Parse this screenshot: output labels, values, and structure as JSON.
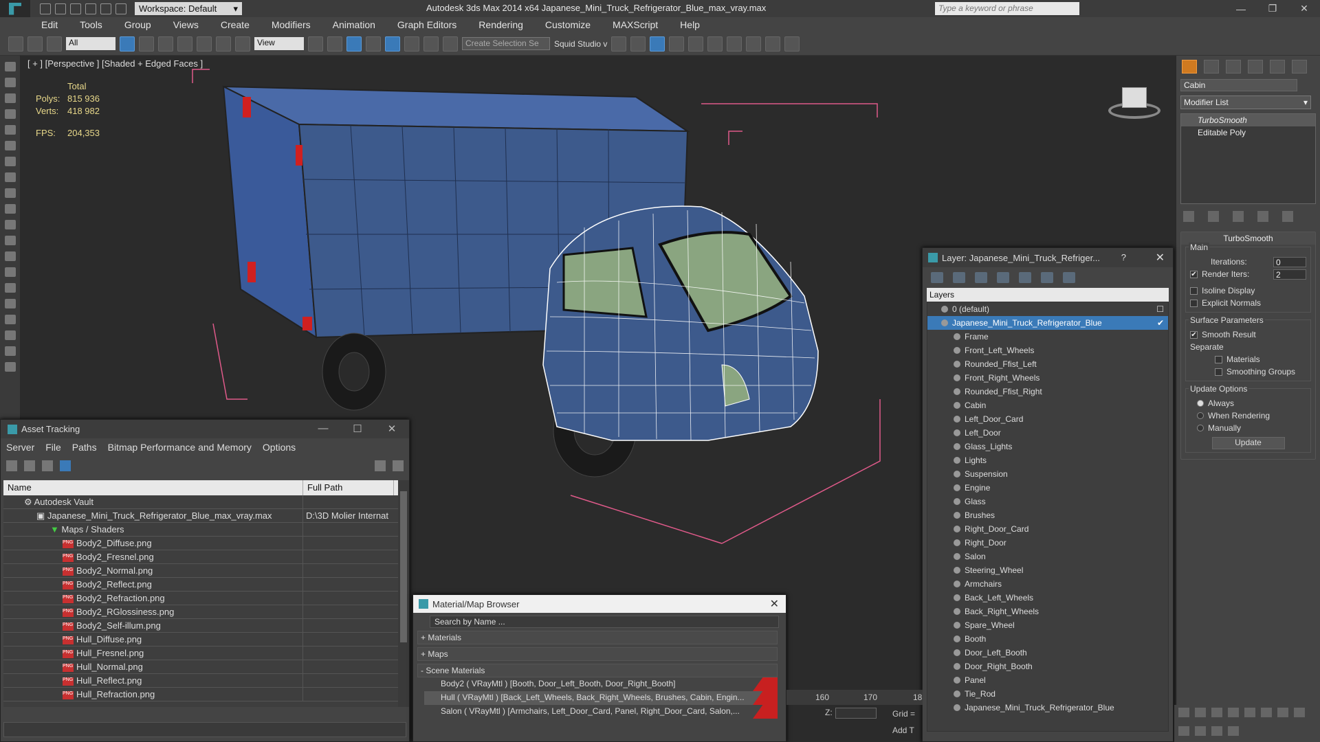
{
  "window": {
    "title": "Autodesk 3ds Max  2014 x64     Japanese_Mini_Truck_Refrigerator_Blue_max_vray.max",
    "workspace": "Workspace: Default",
    "search_placeholder": "Type a keyword or phrase"
  },
  "menu": [
    "Edit",
    "Tools",
    "Group",
    "Views",
    "Create",
    "Modifiers",
    "Animation",
    "Graph Editors",
    "Rendering",
    "Customize",
    "MAXScript",
    "Help"
  ],
  "toolbar": {
    "filter": "All",
    "ref_coord": "View",
    "selection_set": "Create Selection Se",
    "squid": "Squid Studio v"
  },
  "viewport": {
    "label": "[ + ] [Perspective ] [Shaded + Edged Faces ]",
    "stats": {
      "header": "Total",
      "polys_label": "Polys:",
      "polys": "815 936",
      "verts_label": "Verts:",
      "verts": "418 982",
      "fps_label": "FPS:",
      "fps": "204,353"
    }
  },
  "command_panel": {
    "object_name": "Cabin",
    "modifier_list": "Modifier List",
    "stack": [
      "TurboSmooth",
      "Editable Poly"
    ],
    "rollout_title": "TurboSmooth",
    "main_group": "Main",
    "iterations_label": "Iterations:",
    "iterations": "0",
    "render_iters_label": "Render Iters:",
    "render_iters": "2",
    "isoline": "Isoline Display",
    "explicit_normals": "Explicit Normals",
    "surface_group": "Surface Parameters",
    "smooth_result": "Smooth Result",
    "separate": "Separate",
    "materials": "Materials",
    "smoothing_groups": "Smoothing Groups",
    "update_group": "Update Options",
    "always": "Always",
    "when_rendering": "When Rendering",
    "manually": "Manually",
    "update_btn": "Update"
  },
  "layer_window": {
    "title": "Layer: Japanese_Mini_Truck_Refriger...",
    "help": "?",
    "header": "Layers",
    "default_layer": "0 (default)",
    "selected_layer": "Japanese_Mini_Truck_Refrigerator_Blue",
    "items": [
      "Frame",
      "Front_Left_Wheels",
      "Rounded_Ffist_Left",
      "Front_Right_Wheels",
      "Rounded_Ffist_Right",
      "Cabin",
      "Left_Door_Card",
      "Left_Door",
      "Glass_Lights",
      "Lights",
      "Suspension",
      "Engine",
      "Glass",
      "Brushes",
      "Right_Door_Card",
      "Right_Door",
      "Salon",
      "Steering_Wheel",
      "Armchairs",
      "Back_Left_Wheels",
      "Back_Right_Wheels",
      "Spare_Wheel",
      "Booth",
      "Door_Left_Booth",
      "Door_Right_Booth",
      "Panel",
      "Tie_Rod",
      "Japanese_Mini_Truck_Refrigerator_Blue"
    ]
  },
  "asset_window": {
    "title": "Asset Tracking",
    "menu": [
      "Server",
      "File",
      "Paths",
      "Bitmap Performance and Memory",
      "Options"
    ],
    "col_name": "Name",
    "col_path": "Full Path",
    "vault": "Autodesk Vault",
    "file": "Japanese_Mini_Truck_Refrigerator_Blue_max_vray.max",
    "file_path": "D:\\3D Molier Internat",
    "maps_folder": "Maps / Shaders",
    "maps": [
      "Body2_Diffuse.png",
      "Body2_Fresnel.png",
      "Body2_Normal.png",
      "Body2_Reflect.png",
      "Body2_Refraction.png",
      "Body2_RGlossiness.png",
      "Body2_Self-illum.png",
      "Hull_Diffuse.png",
      "Hull_Fresnel.png",
      "Hull_Normal.png",
      "Hull_Reflect.png",
      "Hull_Refraction.png"
    ]
  },
  "material_window": {
    "title": "Material/Map Browser",
    "search": "Search by Name ...",
    "sections": [
      "+ Materials",
      "+ Maps",
      "- Scene Materials"
    ],
    "items": [
      "Body2  ( VRayMtl )  [Booth, Door_Left_Booth, Door_Right_Booth]",
      "Hull  ( VRayMtl )  [Back_Left_Wheels, Back_Right_Wheels, Brushes, Cabin, Engin...",
      "Salon  ( VRayMtl )  [Armchairs, Left_Door_Card, Panel, Right_Door_Card, Salon,..."
    ]
  },
  "bottom": {
    "ruler_160": "160",
    "ruler_170": "170",
    "ruler_18": "18",
    "z_label": "Z:",
    "grid_label": "Grid =",
    "add_t": "Add T"
  },
  "colors": {
    "accent": "#3a7ab8",
    "truck_box": "#3d5a8c",
    "bbox": "#e05a8a",
    "stats": "#e8d88a"
  }
}
